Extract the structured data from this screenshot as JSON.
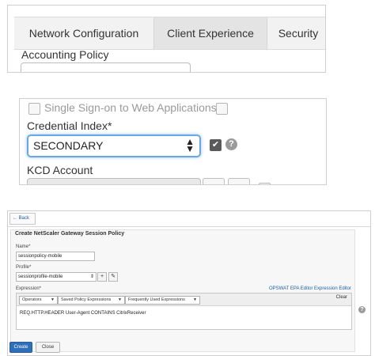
{
  "panel1": {
    "tabs": [
      {
        "label": "Network Configuration",
        "active": false
      },
      {
        "label": "Client Experience",
        "active": true
      },
      {
        "label": "Security",
        "active": false
      }
    ],
    "accounting_policy_label": "Accounting Policy",
    "accounting_policy_value": ""
  },
  "panel2": {
    "sso_label": "Single Sign-on to Web Applications",
    "sso_checked": false,
    "credential_index_label": "Credential Index*",
    "credential_index_value": "SECONDARY",
    "override_checked": true,
    "kcd_label": "KCD Account",
    "kcd_value": ""
  },
  "panel3": {
    "back_label": "Back",
    "section_title": "Create NetScaler Gateway Session Policy",
    "name_label": "Name*",
    "name_value": "sessionpolicy-mobile",
    "profile_label": "Profile*",
    "profile_value": "sessionprofile-mobile",
    "expression_label": "Expression*",
    "opswat_link": "OPSWAT EPA Editor",
    "expression_editor_link": "Expression Editor",
    "operators_label": "Operators",
    "saved_expr_label": "Saved Policy Expressions",
    "freq_expr_label": "Frequently Used Expressions",
    "clear_label": "Clear",
    "expression_value": "REQ.HTTP.HEADER User-Agent CONTAINS CitrixReceiver",
    "create_label": "Create",
    "close_label": "Close"
  },
  "colors": {
    "primary_button": "#2e6fb7",
    "link": "#1e5fa8",
    "focus_ring": "#6aa7e6"
  },
  "icons": [
    "help-icon",
    "checkbox-icon",
    "dropdown-arrow-icon",
    "add-icon",
    "edit-pencil-icon",
    "back-arrow-icon"
  ]
}
